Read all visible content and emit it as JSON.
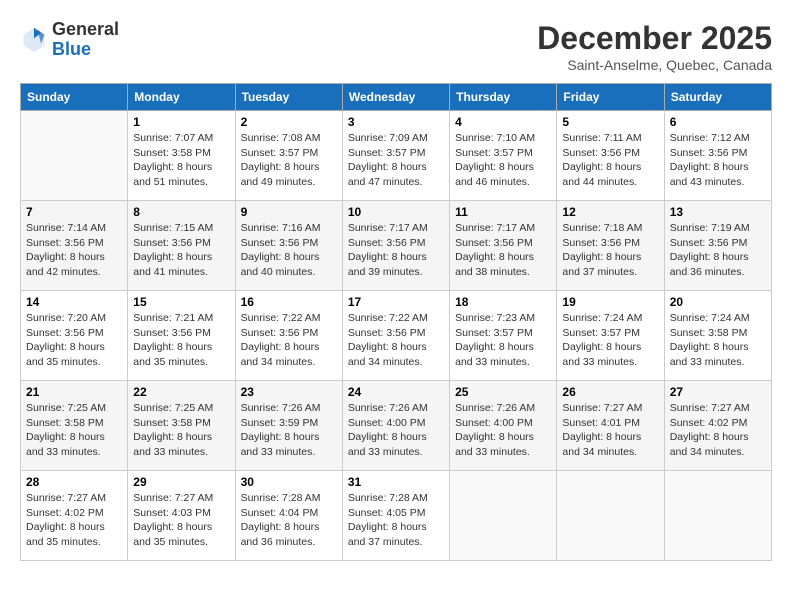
{
  "header": {
    "logo_general": "General",
    "logo_blue": "Blue",
    "month_title": "December 2025",
    "location": "Saint-Anselme, Quebec, Canada"
  },
  "weekdays": [
    "Sunday",
    "Monday",
    "Tuesday",
    "Wednesday",
    "Thursday",
    "Friday",
    "Saturday"
  ],
  "weeks": [
    [
      {
        "day": "",
        "info": ""
      },
      {
        "day": "1",
        "info": "Sunrise: 7:07 AM\nSunset: 3:58 PM\nDaylight: 8 hours\nand 51 minutes."
      },
      {
        "day": "2",
        "info": "Sunrise: 7:08 AM\nSunset: 3:57 PM\nDaylight: 8 hours\nand 49 minutes."
      },
      {
        "day": "3",
        "info": "Sunrise: 7:09 AM\nSunset: 3:57 PM\nDaylight: 8 hours\nand 47 minutes."
      },
      {
        "day": "4",
        "info": "Sunrise: 7:10 AM\nSunset: 3:57 PM\nDaylight: 8 hours\nand 46 minutes."
      },
      {
        "day": "5",
        "info": "Sunrise: 7:11 AM\nSunset: 3:56 PM\nDaylight: 8 hours\nand 44 minutes."
      },
      {
        "day": "6",
        "info": "Sunrise: 7:12 AM\nSunset: 3:56 PM\nDaylight: 8 hours\nand 43 minutes."
      }
    ],
    [
      {
        "day": "7",
        "info": "Sunrise: 7:14 AM\nSunset: 3:56 PM\nDaylight: 8 hours\nand 42 minutes."
      },
      {
        "day": "8",
        "info": "Sunrise: 7:15 AM\nSunset: 3:56 PM\nDaylight: 8 hours\nand 41 minutes."
      },
      {
        "day": "9",
        "info": "Sunrise: 7:16 AM\nSunset: 3:56 PM\nDaylight: 8 hours\nand 40 minutes."
      },
      {
        "day": "10",
        "info": "Sunrise: 7:17 AM\nSunset: 3:56 PM\nDaylight: 8 hours\nand 39 minutes."
      },
      {
        "day": "11",
        "info": "Sunrise: 7:17 AM\nSunset: 3:56 PM\nDaylight: 8 hours\nand 38 minutes."
      },
      {
        "day": "12",
        "info": "Sunrise: 7:18 AM\nSunset: 3:56 PM\nDaylight: 8 hours\nand 37 minutes."
      },
      {
        "day": "13",
        "info": "Sunrise: 7:19 AM\nSunset: 3:56 PM\nDaylight: 8 hours\nand 36 minutes."
      }
    ],
    [
      {
        "day": "14",
        "info": "Sunrise: 7:20 AM\nSunset: 3:56 PM\nDaylight: 8 hours\nand 35 minutes."
      },
      {
        "day": "15",
        "info": "Sunrise: 7:21 AM\nSunset: 3:56 PM\nDaylight: 8 hours\nand 35 minutes."
      },
      {
        "day": "16",
        "info": "Sunrise: 7:22 AM\nSunset: 3:56 PM\nDaylight: 8 hours\nand 34 minutes."
      },
      {
        "day": "17",
        "info": "Sunrise: 7:22 AM\nSunset: 3:56 PM\nDaylight: 8 hours\nand 34 minutes."
      },
      {
        "day": "18",
        "info": "Sunrise: 7:23 AM\nSunset: 3:57 PM\nDaylight: 8 hours\nand 33 minutes."
      },
      {
        "day": "19",
        "info": "Sunrise: 7:24 AM\nSunset: 3:57 PM\nDaylight: 8 hours\nand 33 minutes."
      },
      {
        "day": "20",
        "info": "Sunrise: 7:24 AM\nSunset: 3:58 PM\nDaylight: 8 hours\nand 33 minutes."
      }
    ],
    [
      {
        "day": "21",
        "info": "Sunrise: 7:25 AM\nSunset: 3:58 PM\nDaylight: 8 hours\nand 33 minutes."
      },
      {
        "day": "22",
        "info": "Sunrise: 7:25 AM\nSunset: 3:58 PM\nDaylight: 8 hours\nand 33 minutes."
      },
      {
        "day": "23",
        "info": "Sunrise: 7:26 AM\nSunset: 3:59 PM\nDaylight: 8 hours\nand 33 minutes."
      },
      {
        "day": "24",
        "info": "Sunrise: 7:26 AM\nSunset: 4:00 PM\nDaylight: 8 hours\nand 33 minutes."
      },
      {
        "day": "25",
        "info": "Sunrise: 7:26 AM\nSunset: 4:00 PM\nDaylight: 8 hours\nand 33 minutes."
      },
      {
        "day": "26",
        "info": "Sunrise: 7:27 AM\nSunset: 4:01 PM\nDaylight: 8 hours\nand 34 minutes."
      },
      {
        "day": "27",
        "info": "Sunrise: 7:27 AM\nSunset: 4:02 PM\nDaylight: 8 hours\nand 34 minutes."
      }
    ],
    [
      {
        "day": "28",
        "info": "Sunrise: 7:27 AM\nSunset: 4:02 PM\nDaylight: 8 hours\nand 35 minutes."
      },
      {
        "day": "29",
        "info": "Sunrise: 7:27 AM\nSunset: 4:03 PM\nDaylight: 8 hours\nand 35 minutes."
      },
      {
        "day": "30",
        "info": "Sunrise: 7:28 AM\nSunset: 4:04 PM\nDaylight: 8 hours\nand 36 minutes."
      },
      {
        "day": "31",
        "info": "Sunrise: 7:28 AM\nSunset: 4:05 PM\nDaylight: 8 hours\nand 37 minutes."
      },
      {
        "day": "",
        "info": ""
      },
      {
        "day": "",
        "info": ""
      },
      {
        "day": "",
        "info": ""
      }
    ]
  ]
}
